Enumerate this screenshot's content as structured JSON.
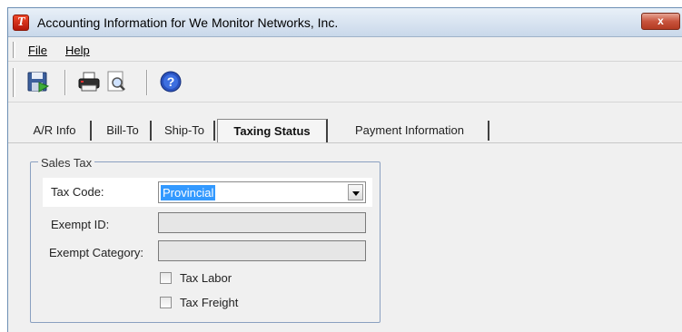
{
  "window": {
    "title": "Accounting Information for We Monitor Networks, Inc.",
    "close_label": "x"
  },
  "menu": {
    "file": "File",
    "help": "Help"
  },
  "toolbar": {
    "buttons": [
      {
        "name": "save-icon"
      },
      {
        "name": "print-icon"
      },
      {
        "name": "print-preview-icon"
      },
      {
        "name": "help-icon"
      }
    ]
  },
  "tabs": [
    {
      "label": "A/R Info",
      "active": false
    },
    {
      "label": "Bill-To",
      "active": false
    },
    {
      "label": "Ship-To",
      "active": false
    },
    {
      "label": "Taxing Status",
      "active": true
    },
    {
      "label": "Payment Information",
      "active": false
    }
  ],
  "sales_tax": {
    "legend": "Sales Tax",
    "tax_code_label": "Tax Code:",
    "tax_code_value": "Provincial",
    "exempt_id_label": "Exempt ID:",
    "exempt_id_value": "",
    "exempt_category_label": "Exempt Category:",
    "exempt_category_value": "",
    "tax_labor_label": "Tax Labor",
    "tax_labor_checked": false,
    "tax_freight_label": "Tax Freight",
    "tax_freight_checked": false
  },
  "colors": {
    "selection": "#3399ff",
    "titlebar": "#c9d8ea",
    "close_button": "#c8543d"
  }
}
